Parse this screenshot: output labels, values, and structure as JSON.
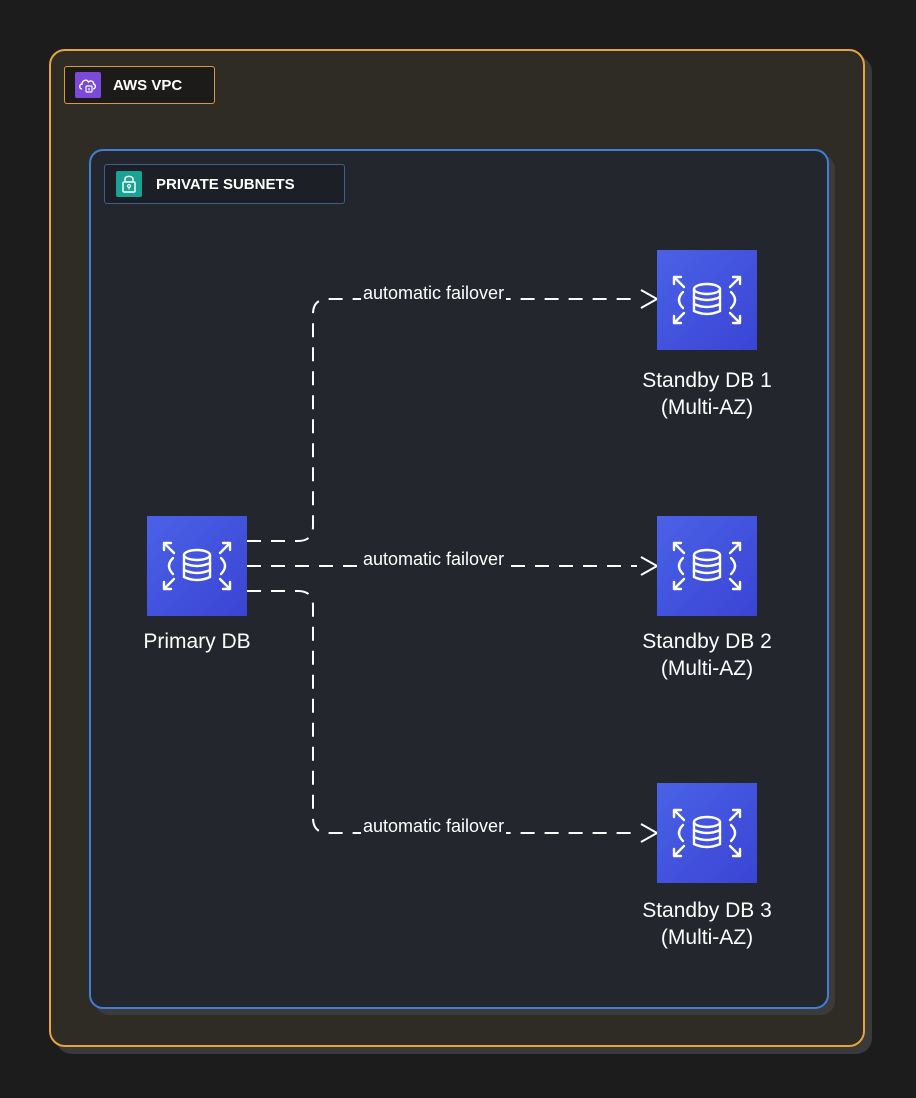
{
  "vpc": {
    "label": "AWS VPC",
    "border_color": "#e8a33d",
    "icon": "vpc-cloud-icon",
    "icon_color": "#7b4ad9"
  },
  "subnet": {
    "label": "PRIVATE SUBNETS",
    "border_color": "#3f7fd8",
    "icon": "padlock-icon",
    "icon_color": "#1aa394"
  },
  "nodes": {
    "primary": {
      "label": "Primary DB",
      "icon": "rds-database-icon"
    },
    "standby1": {
      "line1": "Standby DB 1",
      "line2": "(Multi-AZ)",
      "icon": "rds-database-icon"
    },
    "standby2": {
      "line1": "Standby DB 2",
      "line2": "(Multi-AZ)",
      "icon": "rds-database-icon"
    },
    "standby3": {
      "line1": "Standby DB 3",
      "line2": "(Multi-AZ)",
      "icon": "rds-database-icon"
    }
  },
  "edges": [
    {
      "from": "Primary DB",
      "to": "Standby DB 1",
      "label": "automatic failover",
      "style": "dashed"
    },
    {
      "from": "Primary DB",
      "to": "Standby DB 2",
      "label": "automatic failover",
      "style": "dashed"
    },
    {
      "from": "Primary DB",
      "to": "Standby DB 3",
      "label": "automatic failover",
      "style": "dashed"
    }
  ]
}
